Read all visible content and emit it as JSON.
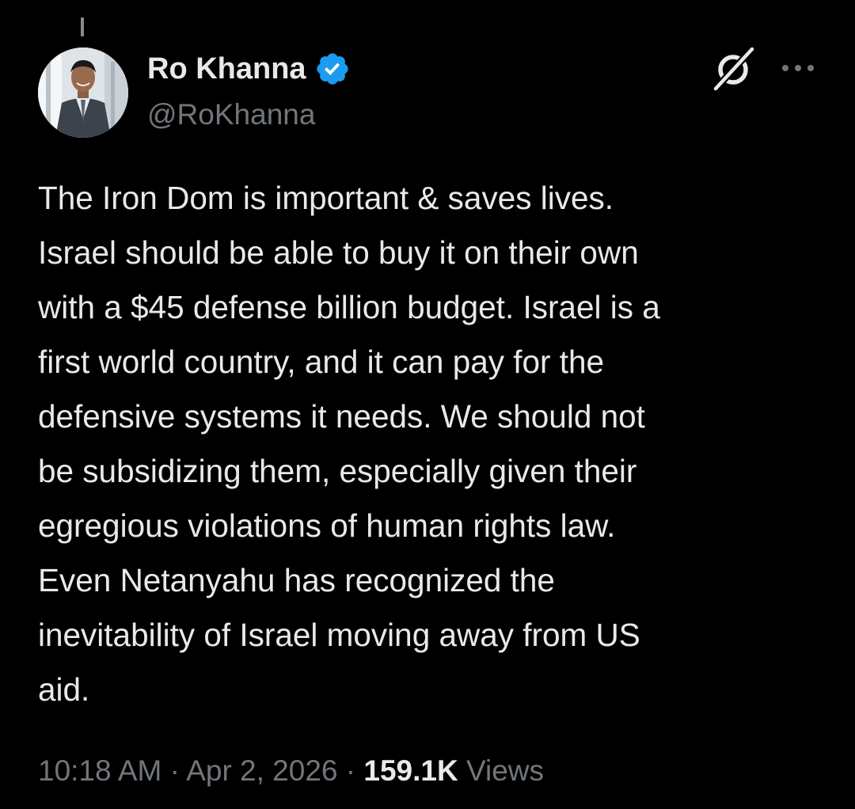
{
  "author": {
    "display_name": "Ro Khanna",
    "handle": "@RoKhanna",
    "verified": true,
    "avatar_icon": "profile-photo"
  },
  "header_icons": {
    "grok": "grok-icon",
    "more": "more-options-icon"
  },
  "tweet": {
    "text": "The Iron Dom is important & saves lives.\nIsrael should be able to buy it on their own\nwith a $45 defense billion budget. Israel is a\nfirst world country, and it can pay for the\ndefensive systems it needs. We should not\nbe subsidizing them, especially given their\negregious violations of human rights law.\nEven Netanyahu has recognized the\ninevitability of Israel moving away from US\naid."
  },
  "meta": {
    "time": "10:18 AM",
    "separator": " · ",
    "date": "Apr 2, 2026",
    "views_count": "159.1K",
    "views_label": " Views"
  },
  "colors": {
    "background": "#000000",
    "text_primary": "#e7e9ea",
    "text_secondary": "#71767b",
    "verified_badge": "#1d9bf0"
  }
}
